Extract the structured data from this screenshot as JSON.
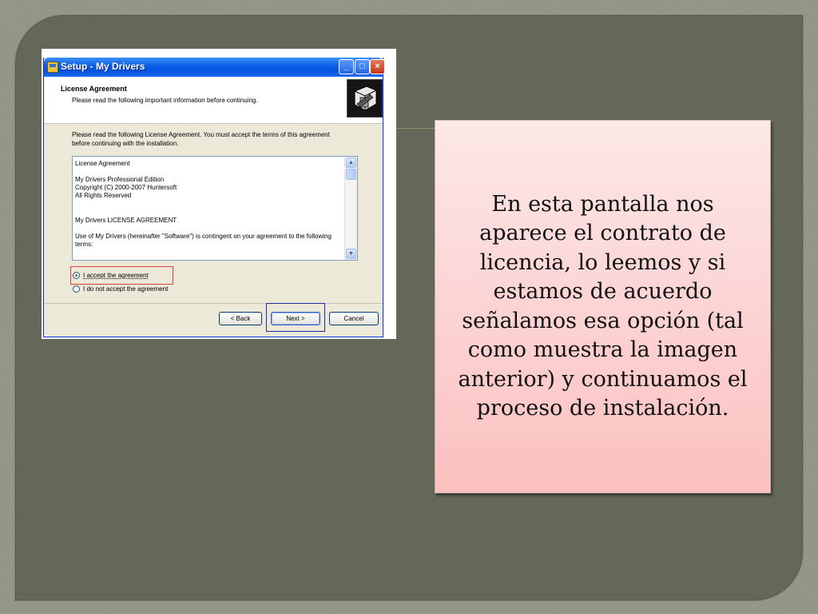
{
  "window": {
    "title": "Setup - My Drivers",
    "header_title": "License Agreement",
    "header_subtitle": "Please read the following important information before continuing.",
    "instructions": "Please read the following License Agreement. You must accept the terms of this agreement before continuing with the installation."
  },
  "license": {
    "line1": "License Agreement",
    "line2": "My Drivers Professional Edition",
    "line3": "Copyright (C) 2000-2007 Huntersoft",
    "line4": "All Rights Reserved",
    "line5": "My Drivers LICENSE AGREEMENT",
    "line6": "Use of My Drivers (hereinafter \"Software\") is contingent on your agreement to the following terms:"
  },
  "options": {
    "accept": "I accept the agreement",
    "decline": "I do not accept the agreement",
    "selected": "accept"
  },
  "buttons": {
    "back": "< Back",
    "next": "Next >",
    "cancel": "Cancel"
  },
  "note": {
    "text": "En esta pantalla nos aparece el contrato de licencia, lo leemos y si estamos de acuerdo señalamos esa opción (tal como muestra la imagen anterior) y continuamos el proceso de instalación."
  }
}
